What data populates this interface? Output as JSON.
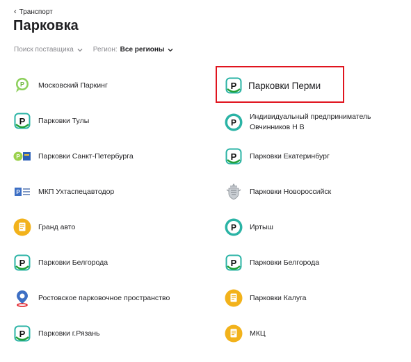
{
  "breadcrumb": {
    "back_label": "Транспорт"
  },
  "page_title": "Парковка",
  "filters": {
    "supplier_search": "Поиск поставщика",
    "region_label": "Регион:",
    "region_value": "Все регионы"
  },
  "providers": {
    "left": [
      {
        "name": "Московский Паркинг",
        "icon": "moscow-parking-logo"
      },
      {
        "name": "Парковки Тулы",
        "icon": "parking-p-icon"
      },
      {
        "name": "Парковки Санкт-Петербурга",
        "icon": "spb-parking-logo"
      },
      {
        "name": "МКП Ухтаспецавтодор",
        "icon": "ukhta-logo"
      },
      {
        "name": "Гранд авто",
        "icon": "document-icon"
      },
      {
        "name": "Парковки Белгорода",
        "icon": "parking-p-icon"
      },
      {
        "name": "Ростовское парковочное пространство",
        "icon": "map-pin-logo"
      },
      {
        "name": "Парковки г.Рязань",
        "icon": "parking-p-icon"
      }
    ],
    "right": [
      {
        "name": "Парковки Перми",
        "icon": "parking-p-icon"
      },
      {
        "name_line1": "Индивидуальный предприниматель",
        "name_line2": "Овчинников Н В",
        "icon": "parking-p-round-icon"
      },
      {
        "name": "Парковки Екатеринбург",
        "icon": "parking-p-icon"
      },
      {
        "name": "Парковки Новороссийск",
        "icon": "coat-of-arms-logo"
      },
      {
        "name": "Иртыш",
        "icon": "parking-p-round-icon"
      },
      {
        "name": "Парковки Белгорода",
        "icon": "parking-p-icon"
      },
      {
        "name": "Парковки Калуга",
        "icon": "document-icon"
      },
      {
        "name": "МКЦ",
        "icon": "document-icon"
      }
    ]
  },
  "colors": {
    "highlight_border": "#e0141e",
    "parking_green": "#21a038",
    "parking_teal": "#2ab3a5",
    "document_yellow": "#f2b21b",
    "text_muted": "#8a8a8f"
  }
}
